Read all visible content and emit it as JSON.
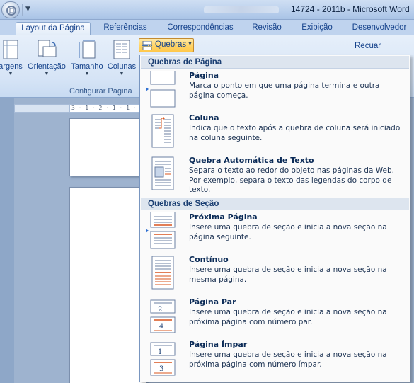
{
  "window": {
    "title": "14724 - 2011b - Microsoft Word"
  },
  "tabs": [
    {
      "label": "Layout da Página",
      "active": true
    },
    {
      "label": "Referências"
    },
    {
      "label": "Correspondências"
    },
    {
      "label": "Revisão"
    },
    {
      "label": "Exibição"
    },
    {
      "label": "Desenvolvedor"
    }
  ],
  "ribbon": {
    "buttons": {
      "margens": "argens",
      "orientacao": "Orientação",
      "tamanho": "Tamanho",
      "colunas": "Colunas",
      "quebras": "Quebras",
      "recuar": "Recuar"
    },
    "group_label": "Configurar Página"
  },
  "ruler": {
    "text": "3 · 1 · 2 · 1 · 1 · 1"
  },
  "menu": {
    "page_breaks_header": "Quebras de Página",
    "section_breaks_header": "Quebras de Seção",
    "items": [
      {
        "title": "Página",
        "desc": "Marca o ponto em que uma página termina e outra página começa.",
        "icon": "page-break-icon"
      },
      {
        "title": "Coluna",
        "desc": "Indica que o texto após a quebra de coluna será iniciado na coluna seguinte.",
        "icon": "column-break-icon"
      },
      {
        "title": "Quebra Automática de Texto",
        "desc": "Separa o texto ao redor do objeto nas páginas da Web. Por exemplo, separa o texto das legendas do corpo de texto.",
        "icon": "text-wrapping-break-icon"
      },
      {
        "title": "Próxima Página",
        "desc": "Insere uma quebra de seção e inicia a nova seção na página seguinte.",
        "icon": "next-page-break-icon"
      },
      {
        "title": "Contínuo",
        "desc": "Insere uma quebra de seção e inicia a nova seção na mesma página.",
        "icon": "continuous-break-icon"
      },
      {
        "title": "Página Par",
        "desc": "Insere uma quebra de seção e inicia a nova seção na próxima página com número par.",
        "icon": "even-page-break-icon",
        "icon_digit_top": "2",
        "icon_digit_bottom": "4"
      },
      {
        "title": "Página Ímpar",
        "desc": "Insere uma quebra de seção e inicia a nova seção na próxima página com número ímpar.",
        "icon": "odd-page-break-icon",
        "icon_digit_top": "1",
        "icon_digit_bottom": "3"
      }
    ]
  },
  "colors": {
    "accent": "#15428b",
    "highlight": "#ffd66b",
    "menu_header_bg": "#dde5ef",
    "break_line": "#d9541e"
  }
}
